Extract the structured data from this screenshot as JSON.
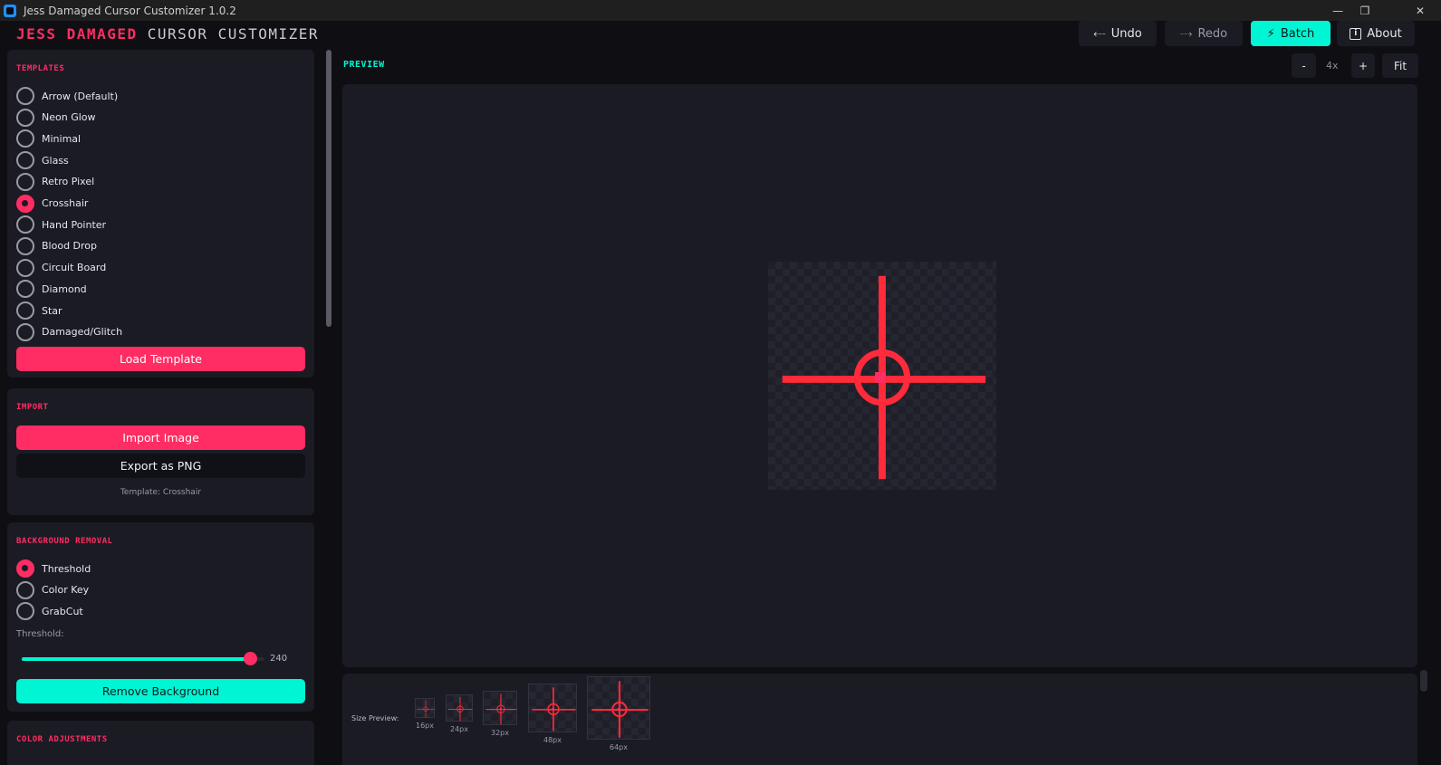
{
  "window": {
    "title": "Jess Damaged Cursor Customizer 1.0.2",
    "controls": [
      "—",
      "❐",
      "✕"
    ]
  },
  "header": {
    "brand_primary": "JESS DAMAGED",
    "brand_secondary": "CURSOR CUSTOMIZER",
    "undo_label": "Undo",
    "redo_label": "Redo",
    "batch_label": "Batch",
    "about_label": "About"
  },
  "templates": {
    "title": "TEMPLATES",
    "items": [
      {
        "label": "Arrow (Default)",
        "selected": false
      },
      {
        "label": "Neon Glow",
        "selected": false
      },
      {
        "label": "Minimal",
        "selected": false
      },
      {
        "label": "Glass",
        "selected": false
      },
      {
        "label": "Retro Pixel",
        "selected": false
      },
      {
        "label": "Crosshair",
        "selected": true
      },
      {
        "label": "Hand Pointer",
        "selected": false
      },
      {
        "label": "Blood Drop",
        "selected": false
      },
      {
        "label": "Circuit Board",
        "selected": false
      },
      {
        "label": "Diamond",
        "selected": false
      },
      {
        "label": "Star",
        "selected": false
      },
      {
        "label": "Damaged/Glitch",
        "selected": false
      }
    ],
    "load_button": "Load Template"
  },
  "import": {
    "title": "IMPORT",
    "import_button": "Import Image",
    "export_button": "Export as PNG",
    "template_note": "Template: Crosshair"
  },
  "background_removal": {
    "title": "BACKGROUND REMOVAL",
    "methods": [
      {
        "label": "Threshold",
        "selected": true
      },
      {
        "label": "Color Key",
        "selected": false
      },
      {
        "label": "GrabCut",
        "selected": false
      }
    ],
    "threshold_label": "Threshold:",
    "threshold_value": "240",
    "threshold_fraction": 0.94,
    "remove_button": "Remove Background"
  },
  "color_adjustments": {
    "title": "COLOR ADJUSTMENTS"
  },
  "preview": {
    "title": "PREVIEW",
    "zoom_out_label": "-",
    "zoom_level": "4x",
    "zoom_in_label": "+",
    "fit_label": "Fit",
    "cursor_color": "#ff2a3a",
    "cursor_center_color": "#ff2d63"
  },
  "size_preview": {
    "label": "Size Preview:",
    "sizes": [
      "16px",
      "24px",
      "32px",
      "48px",
      "64px"
    ]
  },
  "colors": {
    "accent_pink": "#ff2d63",
    "accent_teal": "#00f5d4",
    "background": "#0e0e13",
    "panel": "#1b1b24"
  }
}
